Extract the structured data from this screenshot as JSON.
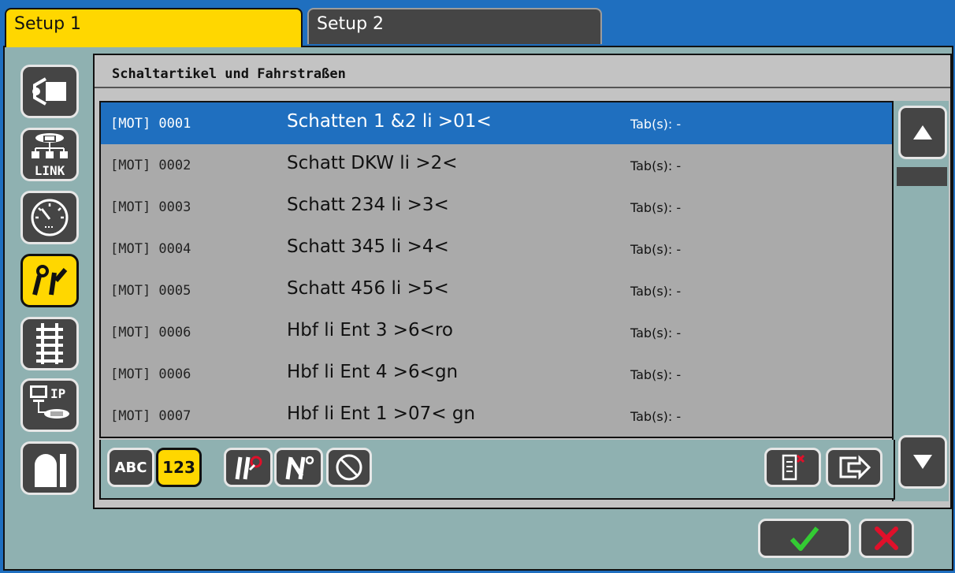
{
  "tabs": [
    {
      "label": "Setup 1",
      "active": true
    },
    {
      "label": "Setup 2",
      "active": false
    }
  ],
  "sidebar": {
    "items": [
      {
        "name": "connection",
        "icon": "plug-icon"
      },
      {
        "name": "link",
        "icon": "network-link-icon",
        "label": "LINK"
      },
      {
        "name": "gauge",
        "icon": "gauge-icon"
      },
      {
        "name": "accessories",
        "icon": "switch-signal-icon",
        "active": true
      },
      {
        "name": "track",
        "icon": "track-icon"
      },
      {
        "name": "ip",
        "icon": "ip-network-icon",
        "label": "IP"
      },
      {
        "name": "tunnel",
        "icon": "tunnel-icon"
      }
    ]
  },
  "panel": {
    "title": "Schaltartikel und Fahrstraßen"
  },
  "list": {
    "rows": [
      {
        "code": "[MOT] 0001",
        "name": "Schatten 1 &2 li >01<",
        "tabs": "Tab(s): -",
        "selected": true
      },
      {
        "code": "[MOT] 0002",
        "name": "Schatt DKW li >2<",
        "tabs": "Tab(s): -"
      },
      {
        "code": "[MOT] 0003",
        "name": "Schatt 234 li >3<",
        "tabs": "Tab(s): -"
      },
      {
        "code": "[MOT] 0004",
        "name": "Schatt 345 li >4<",
        "tabs": "Tab(s): -"
      },
      {
        "code": "[MOT] 0005",
        "name": "Schatt 456 li >5<",
        "tabs": "Tab(s): -"
      },
      {
        "code": "[MOT] 0006",
        "name": "Hbf li Ent 3 >6<ro",
        "tabs": "Tab(s): -"
      },
      {
        "code": "[MOT] 0006",
        "name": "Hbf li Ent 4 >6<gn",
        "tabs": "Tab(s): -"
      },
      {
        "code": "[MOT] 0007",
        "name": "Hbf li Ent 1 >07< gn",
        "tabs": "Tab(s): -"
      }
    ]
  },
  "toolbar": {
    "sort_abc_label": "ABC",
    "sort_123_label": "123",
    "sort_123_active": true,
    "filters": [
      "switch-filter-icon",
      "signal-filter-icon",
      "no-filter-icon"
    ],
    "actions": [
      "delete-edit-icon",
      "export-icon"
    ]
  },
  "scroll": {
    "up": "arrow-up-icon",
    "down": "arrow-down-icon"
  },
  "confirm": {
    "ok": "check-icon",
    "cancel": "cross-icon"
  },
  "colors": {
    "tab_active": "#ffd700",
    "selection": "#1f6fbf",
    "frame": "#8fb1b1",
    "check": "#33cc33",
    "cross": "#e0102a"
  }
}
